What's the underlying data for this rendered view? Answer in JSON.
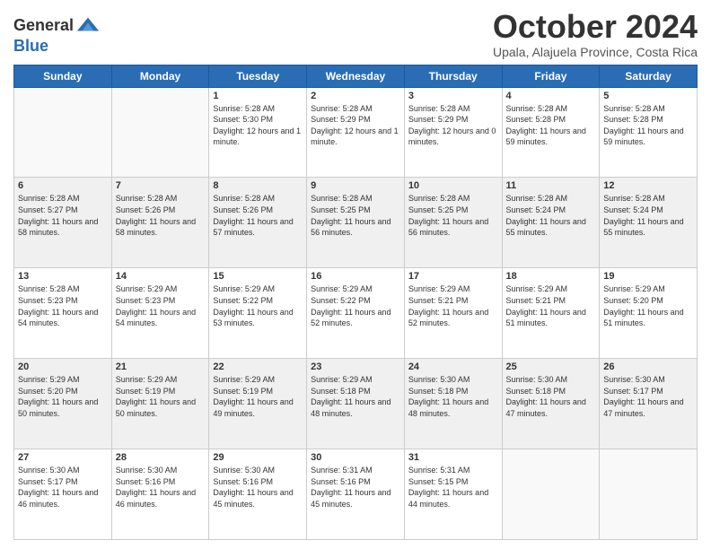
{
  "logo": {
    "general": "General",
    "blue": "Blue"
  },
  "title": "October 2024",
  "subtitle": "Upala, Alajuela Province, Costa Rica",
  "days_of_week": [
    "Sunday",
    "Monday",
    "Tuesday",
    "Wednesday",
    "Thursday",
    "Friday",
    "Saturday"
  ],
  "weeks": [
    [
      {
        "day": "",
        "sunrise": "",
        "sunset": "",
        "daylight": ""
      },
      {
        "day": "",
        "sunrise": "",
        "sunset": "",
        "daylight": ""
      },
      {
        "day": "1",
        "sunrise": "Sunrise: 5:28 AM",
        "sunset": "Sunset: 5:30 PM",
        "daylight": "Daylight: 12 hours and 1 minute."
      },
      {
        "day": "2",
        "sunrise": "Sunrise: 5:28 AM",
        "sunset": "Sunset: 5:29 PM",
        "daylight": "Daylight: 12 hours and 1 minute."
      },
      {
        "day": "3",
        "sunrise": "Sunrise: 5:28 AM",
        "sunset": "Sunset: 5:29 PM",
        "daylight": "Daylight: 12 hours and 0 minutes."
      },
      {
        "day": "4",
        "sunrise": "Sunrise: 5:28 AM",
        "sunset": "Sunset: 5:28 PM",
        "daylight": "Daylight: 11 hours and 59 minutes."
      },
      {
        "day": "5",
        "sunrise": "Sunrise: 5:28 AM",
        "sunset": "Sunset: 5:28 PM",
        "daylight": "Daylight: 11 hours and 59 minutes."
      }
    ],
    [
      {
        "day": "6",
        "sunrise": "Sunrise: 5:28 AM",
        "sunset": "Sunset: 5:27 PM",
        "daylight": "Daylight: 11 hours and 58 minutes."
      },
      {
        "day": "7",
        "sunrise": "Sunrise: 5:28 AM",
        "sunset": "Sunset: 5:26 PM",
        "daylight": "Daylight: 11 hours and 58 minutes."
      },
      {
        "day": "8",
        "sunrise": "Sunrise: 5:28 AM",
        "sunset": "Sunset: 5:26 PM",
        "daylight": "Daylight: 11 hours and 57 minutes."
      },
      {
        "day": "9",
        "sunrise": "Sunrise: 5:28 AM",
        "sunset": "Sunset: 5:25 PM",
        "daylight": "Daylight: 11 hours and 56 minutes."
      },
      {
        "day": "10",
        "sunrise": "Sunrise: 5:28 AM",
        "sunset": "Sunset: 5:25 PM",
        "daylight": "Daylight: 11 hours and 56 minutes."
      },
      {
        "day": "11",
        "sunrise": "Sunrise: 5:28 AM",
        "sunset": "Sunset: 5:24 PM",
        "daylight": "Daylight: 11 hours and 55 minutes."
      },
      {
        "day": "12",
        "sunrise": "Sunrise: 5:28 AM",
        "sunset": "Sunset: 5:24 PM",
        "daylight": "Daylight: 11 hours and 55 minutes."
      }
    ],
    [
      {
        "day": "13",
        "sunrise": "Sunrise: 5:28 AM",
        "sunset": "Sunset: 5:23 PM",
        "daylight": "Daylight: 11 hours and 54 minutes."
      },
      {
        "day": "14",
        "sunrise": "Sunrise: 5:29 AM",
        "sunset": "Sunset: 5:23 PM",
        "daylight": "Daylight: 11 hours and 54 minutes."
      },
      {
        "day": "15",
        "sunrise": "Sunrise: 5:29 AM",
        "sunset": "Sunset: 5:22 PM",
        "daylight": "Daylight: 11 hours and 53 minutes."
      },
      {
        "day": "16",
        "sunrise": "Sunrise: 5:29 AM",
        "sunset": "Sunset: 5:22 PM",
        "daylight": "Daylight: 11 hours and 52 minutes."
      },
      {
        "day": "17",
        "sunrise": "Sunrise: 5:29 AM",
        "sunset": "Sunset: 5:21 PM",
        "daylight": "Daylight: 11 hours and 52 minutes."
      },
      {
        "day": "18",
        "sunrise": "Sunrise: 5:29 AM",
        "sunset": "Sunset: 5:21 PM",
        "daylight": "Daylight: 11 hours and 51 minutes."
      },
      {
        "day": "19",
        "sunrise": "Sunrise: 5:29 AM",
        "sunset": "Sunset: 5:20 PM",
        "daylight": "Daylight: 11 hours and 51 minutes."
      }
    ],
    [
      {
        "day": "20",
        "sunrise": "Sunrise: 5:29 AM",
        "sunset": "Sunset: 5:20 PM",
        "daylight": "Daylight: 11 hours and 50 minutes."
      },
      {
        "day": "21",
        "sunrise": "Sunrise: 5:29 AM",
        "sunset": "Sunset: 5:19 PM",
        "daylight": "Daylight: 11 hours and 50 minutes."
      },
      {
        "day": "22",
        "sunrise": "Sunrise: 5:29 AM",
        "sunset": "Sunset: 5:19 PM",
        "daylight": "Daylight: 11 hours and 49 minutes."
      },
      {
        "day": "23",
        "sunrise": "Sunrise: 5:29 AM",
        "sunset": "Sunset: 5:18 PM",
        "daylight": "Daylight: 11 hours and 48 minutes."
      },
      {
        "day": "24",
        "sunrise": "Sunrise: 5:30 AM",
        "sunset": "Sunset: 5:18 PM",
        "daylight": "Daylight: 11 hours and 48 minutes."
      },
      {
        "day": "25",
        "sunrise": "Sunrise: 5:30 AM",
        "sunset": "Sunset: 5:18 PM",
        "daylight": "Daylight: 11 hours and 47 minutes."
      },
      {
        "day": "26",
        "sunrise": "Sunrise: 5:30 AM",
        "sunset": "Sunset: 5:17 PM",
        "daylight": "Daylight: 11 hours and 47 minutes."
      }
    ],
    [
      {
        "day": "27",
        "sunrise": "Sunrise: 5:30 AM",
        "sunset": "Sunset: 5:17 PM",
        "daylight": "Daylight: 11 hours and 46 minutes."
      },
      {
        "day": "28",
        "sunrise": "Sunrise: 5:30 AM",
        "sunset": "Sunset: 5:16 PM",
        "daylight": "Daylight: 11 hours and 46 minutes."
      },
      {
        "day": "29",
        "sunrise": "Sunrise: 5:30 AM",
        "sunset": "Sunset: 5:16 PM",
        "daylight": "Daylight: 11 hours and 45 minutes."
      },
      {
        "day": "30",
        "sunrise": "Sunrise: 5:31 AM",
        "sunset": "Sunset: 5:16 PM",
        "daylight": "Daylight: 11 hours and 45 minutes."
      },
      {
        "day": "31",
        "sunrise": "Sunrise: 5:31 AM",
        "sunset": "Sunset: 5:15 PM",
        "daylight": "Daylight: 11 hours and 44 minutes."
      },
      {
        "day": "",
        "sunrise": "",
        "sunset": "",
        "daylight": ""
      },
      {
        "day": "",
        "sunrise": "",
        "sunset": "",
        "daylight": ""
      }
    ]
  ]
}
